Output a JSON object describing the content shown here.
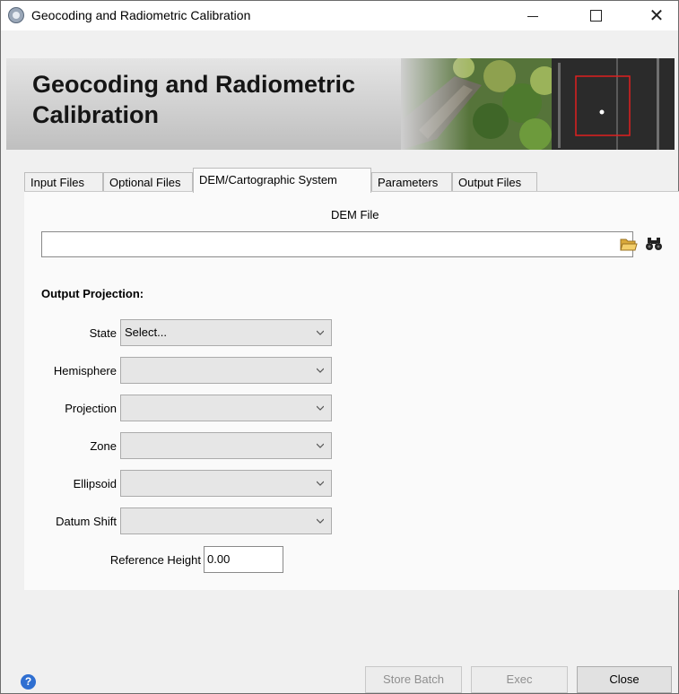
{
  "window": {
    "title": "Geocoding and Radiometric Calibration",
    "controls": {
      "minimize": "—",
      "maximize": "☐",
      "close": "✕"
    }
  },
  "banner": {
    "title": "Geocoding and Radiometric Calibration"
  },
  "tabs": [
    {
      "label": "Input Files",
      "active": false
    },
    {
      "label": "Optional Files",
      "active": false
    },
    {
      "label": "DEM/Cartographic System",
      "active": true
    },
    {
      "label": "Parameters",
      "active": false
    },
    {
      "label": "Output Files",
      "active": false
    }
  ],
  "dem": {
    "label": "DEM File",
    "value": "",
    "open_icon": "folder-open-icon",
    "browse_icon": "binoculars-icon"
  },
  "projection": {
    "section_title": "Output Projection:",
    "fields": [
      {
        "label": "State",
        "value": "Select..."
      },
      {
        "label": "Hemisphere",
        "value": ""
      },
      {
        "label": "Projection",
        "value": ""
      },
      {
        "label": "Zone",
        "value": ""
      },
      {
        "label": "Ellipsoid",
        "value": ""
      },
      {
        "label": "Datum Shift",
        "value": ""
      }
    ],
    "reference_height": {
      "label": "Reference Height",
      "value": "0.00"
    }
  },
  "footer": {
    "help_icon": "help-icon",
    "buttons": [
      {
        "label": "Store Batch",
        "enabled": false
      },
      {
        "label": "Exec",
        "enabled": false
      },
      {
        "label": "Close",
        "enabled": true
      }
    ]
  },
  "colors": {
    "accent": "#2f6fd1",
    "disabled_text": "#8f8f8f"
  }
}
